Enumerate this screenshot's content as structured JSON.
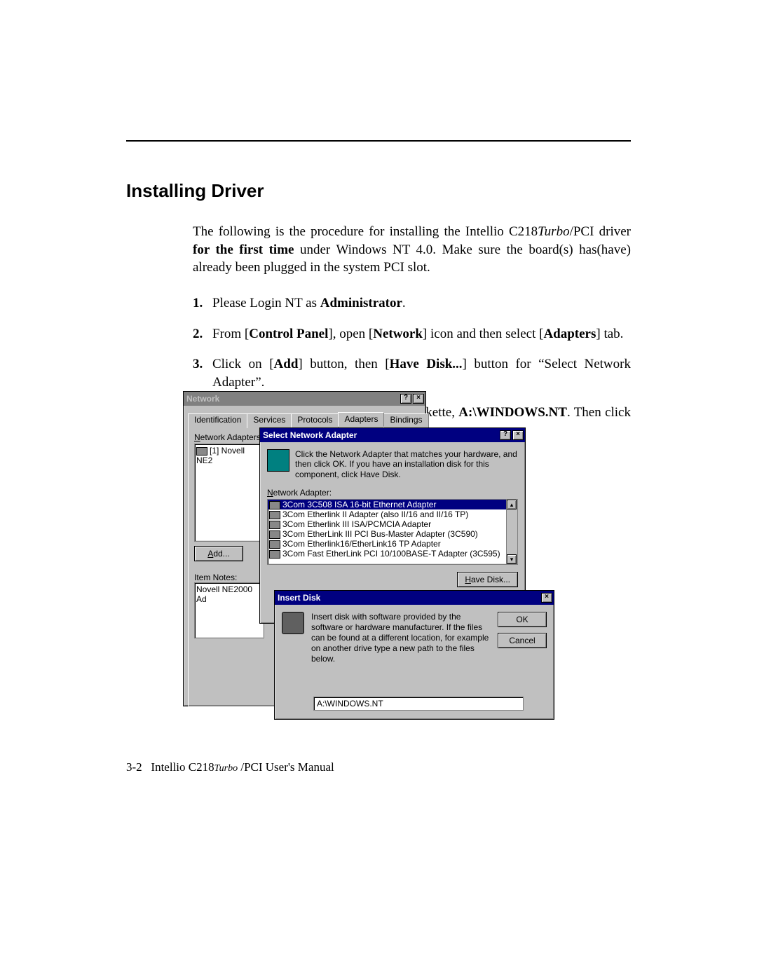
{
  "heading": "Installing Driver",
  "intro_html": "The following is the procedure for installing the Intellio C218<i>Turbo</i>/PCI driver <b>for the first time</b> under Windows NT 4.0. Make sure the board(s) has(have) already been plugged in the system PCI slot.",
  "steps": [
    "Please Login NT as <b>Administrator</b>.",
    "From [<b>Control Panel</b>], open [<b>Network</b>] icon and then select [<b>Adapters</b>] tab.",
    "Click on [<b>Add</b>] button, then [<b>Have Disk...</b>] button for “Select Network Adapter”.",
    "Specify the exact path for the driver diskette, <b>A:\\WINDOWS.NT</b>. Then click on [<b>OK</b>] button."
  ],
  "network_window": {
    "title": "Network",
    "help_btn": "?",
    "close_btn": "×",
    "tabs": [
      "Identification",
      "Services",
      "Protocols",
      "Adapters",
      "Bindings"
    ],
    "active_tab_index": 3,
    "net_adapters_label": "Network Adapters:",
    "net_adapters_label_ul": "N",
    "adapter_entry": "[1] Novell NE2",
    "add_btn": "Add...",
    "add_btn_ul": "A",
    "item_notes_label": "Item Notes:",
    "item_notes_value": "Novell NE2000 Ad"
  },
  "select_window": {
    "title": "Select Network Adapter",
    "help_btn": "?",
    "close_btn": "×",
    "instruction": "Click the Network Adapter that matches your hardware, and then click OK.  If you have an installation disk for this component, click Have Disk.",
    "list_label": "Network Adapter:",
    "list_label_ul": "N",
    "items": [
      "3Com 3C508 ISA 16-bit Ethernet Adapter",
      "3Com Etherlink II Adapter (also II/16 and II/16 TP)",
      "3Com Etherlink III ISA/PCMCIA Adapter",
      "3Com EtherLink III PCI Bus-Master Adapter (3C590)",
      "3Com Etherlink16/EtherLink16 TP Adapter",
      "3Com Fast EtherLink PCI 10/100BASE-T Adapter (3C595)"
    ],
    "selected_index": 0,
    "have_disk_btn": "Have Disk...",
    "have_disk_ul": "H"
  },
  "insert_window": {
    "title": "Insert Disk",
    "close_btn": "×",
    "message": "Insert disk with software provided by the software or hardware manufacturer.  If the files can be found at a different location, for example on another drive type a new path to the files below.",
    "ok_btn": "OK",
    "cancel_btn": "Cancel",
    "path_value": "A:\\WINDOWS.NT"
  },
  "footer": {
    "page_num": "3-2",
    "manual_html": "Intellio C218<i style='font-size:14px'>Turbo</i> /PCI User's Manual"
  }
}
